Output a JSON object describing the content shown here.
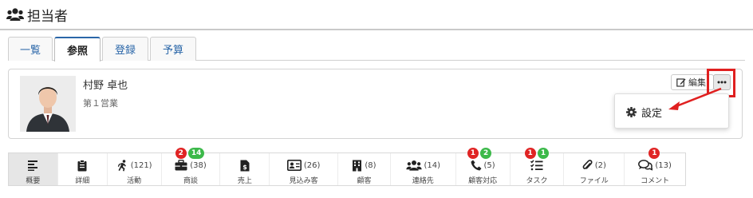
{
  "header": {
    "title": "担当者",
    "icon": "users-icon"
  },
  "tabs": [
    {
      "label": "一覧",
      "active": false
    },
    {
      "label": "参照",
      "active": true
    },
    {
      "label": "登録",
      "active": false
    },
    {
      "label": "予算",
      "active": false
    }
  ],
  "person": {
    "name": "村野 卓也",
    "department": "第１営業",
    "avatar_icon": "person-photo"
  },
  "toolbar": {
    "edit_label": "編集",
    "edit_icon": "edit-icon",
    "more_icon": "ellipsis-icon"
  },
  "menu": {
    "items": [
      {
        "label": "設定",
        "icon": "gear-icon"
      }
    ]
  },
  "annotation": {
    "highlight_color": "#e02020"
  },
  "summary": [
    {
      "label": "概要",
      "count": "",
      "icon": "align-left-icon",
      "active": true,
      "badges": []
    },
    {
      "label": "詳細",
      "count": "",
      "icon": "clipboard-icon",
      "active": false,
      "badges": []
    },
    {
      "label": "活動",
      "count": "(121)",
      "icon": "running-icon",
      "active": false,
      "badges": []
    },
    {
      "label": "商談",
      "count": "(38)",
      "icon": "briefcase-icon",
      "active": false,
      "badges": [
        {
          "value": "2",
          "color": "red"
        },
        {
          "value": "14",
          "color": "green"
        }
      ]
    },
    {
      "label": "売上",
      "count": "",
      "icon": "invoice-dollar-icon",
      "active": false,
      "badges": []
    },
    {
      "label": "見込み客",
      "count": "(26)",
      "icon": "id-card-icon",
      "active": false,
      "badges": []
    },
    {
      "label": "顧客",
      "count": "(8)",
      "icon": "building-icon",
      "active": false,
      "badges": []
    },
    {
      "label": "連絡先",
      "count": "(14)",
      "icon": "users-icon",
      "active": false,
      "badges": []
    },
    {
      "label": "顧客対応",
      "count": "(5)",
      "icon": "phone-icon",
      "active": false,
      "badges": [
        {
          "value": "1",
          "color": "red"
        },
        {
          "value": "2",
          "color": "green"
        }
      ]
    },
    {
      "label": "タスク",
      "count": "",
      "icon": "task-list-icon",
      "active": false,
      "badges": [
        {
          "value": "1",
          "color": "red"
        },
        {
          "value": "1",
          "color": "green"
        }
      ]
    },
    {
      "label": "ファイル",
      "count": "(2)",
      "icon": "paperclip-icon",
      "active": false,
      "badges": []
    },
    {
      "label": "コメント",
      "count": "(13)",
      "icon": "comments-icon",
      "active": false,
      "badges": [
        {
          "value": "1",
          "color": "red"
        }
      ]
    }
  ]
}
